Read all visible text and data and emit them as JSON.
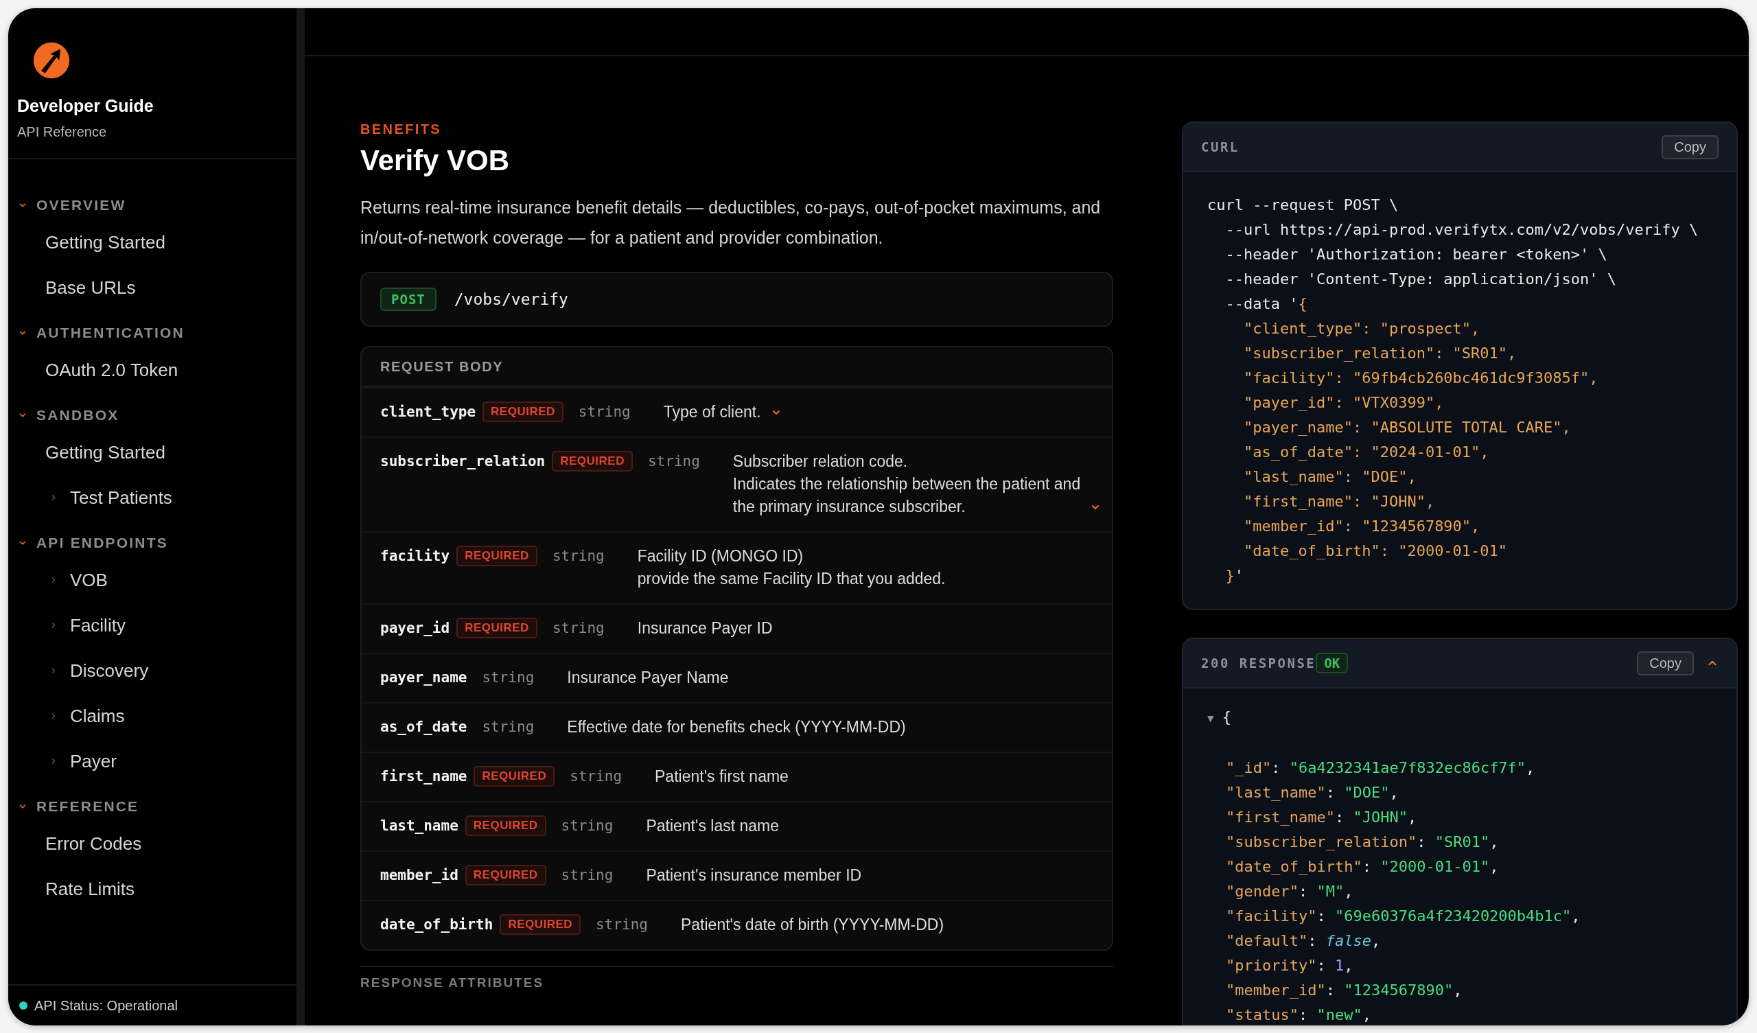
{
  "brand": {
    "title": "Developer Guide",
    "subtitle": "API Reference"
  },
  "nav": [
    {
      "label": "OVERVIEW",
      "expanded": true,
      "items": [
        {
          "label": "Getting Started",
          "kind": "link"
        },
        {
          "label": "Base URLs",
          "kind": "link"
        }
      ]
    },
    {
      "label": "AUTHENTICATION",
      "expanded": true,
      "items": [
        {
          "label": "OAuth 2.0 Token",
          "kind": "link"
        }
      ]
    },
    {
      "label": "SANDBOX",
      "expanded": true,
      "items": [
        {
          "label": "Getting Started",
          "kind": "link"
        },
        {
          "label": "Test Patients",
          "kind": "group",
          "expanded": false
        }
      ]
    },
    {
      "label": "API ENDPOINTS",
      "expanded": true,
      "items": [
        {
          "label": "VOB",
          "kind": "group",
          "expanded": false
        },
        {
          "label": "Facility",
          "kind": "group",
          "expanded": false
        },
        {
          "label": "Discovery",
          "kind": "group",
          "expanded": false
        },
        {
          "label": "Claims",
          "kind": "group",
          "expanded": false
        },
        {
          "label": "Payer",
          "kind": "group",
          "expanded": false
        }
      ]
    },
    {
      "label": "REFERENCE",
      "expanded": true,
      "items": [
        {
          "label": "Error Codes",
          "kind": "link"
        },
        {
          "label": "Rate Limits",
          "kind": "link"
        }
      ]
    }
  ],
  "status": {
    "text": "API Status: Operational",
    "color": "#2dd4bf"
  },
  "page": {
    "eyebrow": "BENEFITS",
    "title": "Verify VOB",
    "description": "Returns real-time insurance benefit details — deductibles, co-pays, out-of-pocket maximums, and in/out-of-network coverage — for a patient and provider combination."
  },
  "endpoint": {
    "method": "POST",
    "path": "/vobs/verify"
  },
  "request_body": {
    "heading": "REQUEST BODY",
    "fields": [
      {
        "name": "client_type",
        "badge": "REQUIRED",
        "type": "string",
        "description": [
          "Type of client."
        ],
        "expandable": true
      },
      {
        "name": "subscriber_relation",
        "badge": "REQUIRED",
        "type": "string",
        "description": [
          "Subscriber relation code.",
          "Indicates the relationship between the patient and",
          "the primary insurance subscriber."
        ],
        "expandable": true
      },
      {
        "name": "facility",
        "badge": "REQUIRED",
        "type": "string",
        "description": [
          "Facility ID (MONGO ID)",
          "provide the same Facility ID that you added."
        ],
        "expandable": false
      },
      {
        "name": "payer_id",
        "badge": "REQUIRED",
        "type": "string",
        "description": [
          "Insurance Payer ID"
        ],
        "expandable": false
      },
      {
        "name": "payer_name",
        "type": "string",
        "description": [
          "Insurance Payer Name"
        ],
        "expandable": false
      },
      {
        "name": "as_of_date",
        "type": "string",
        "description": [
          "Effective date for benefits check (YYYY-MM-DD)"
        ],
        "expandable": false
      },
      {
        "name": "first_name",
        "badge": "REQUIRED",
        "type": "string",
        "description": [
          "Patient's first name"
        ],
        "expandable": false
      },
      {
        "name": "last_name",
        "badge": "REQUIRED",
        "type": "string",
        "description": [
          "Patient's last name"
        ],
        "expandable": false
      },
      {
        "name": "member_id",
        "badge": "REQUIRED",
        "type": "string",
        "description": [
          "Patient's insurance member ID"
        ],
        "expandable": false
      },
      {
        "name": "date_of_birth",
        "badge": "REQUIRED",
        "type": "string",
        "description": [
          "Patient's date of birth (YYYY-MM-DD)"
        ],
        "expandable": false
      }
    ]
  },
  "response_heading": "RESPONSE ATTRIBUTES",
  "curl": {
    "label": "CURL",
    "copy": "Copy",
    "lines": [
      [
        {
          "text": "curl --request POST \\",
          "kind": "plain"
        }
      ],
      [
        {
          "text": "  --url https://api-prod.verifytx.com/v2/vobs/verify \\",
          "kind": "plain"
        }
      ],
      [
        {
          "text": "  --header 'Authorization: bearer <token>' \\",
          "kind": "plain"
        }
      ],
      [
        {
          "text": "  --header 'Content-Type: application/json' \\",
          "kind": "plain"
        }
      ],
      [
        {
          "text": "  --data '",
          "kind": "plain"
        },
        {
          "text": "{",
          "kind": "data"
        }
      ],
      [
        {
          "text": "    \"client_type\": \"prospect\",",
          "kind": "data"
        }
      ],
      [
        {
          "text": "    \"subscriber_relation\": \"SR01\",",
          "kind": "data"
        }
      ],
      [
        {
          "text": "    \"facility\": \"69fb4cb260bc461dc9f3085f\",",
          "kind": "data"
        }
      ],
      [
        {
          "text": "    \"payer_id\": \"VTX0399\",",
          "kind": "data"
        }
      ],
      [
        {
          "text": "    \"payer_name\": \"ABSOLUTE TOTAL CARE\",",
          "kind": "data"
        }
      ],
      [
        {
          "text": "    \"as_of_date\": \"2024-01-01\",",
          "kind": "data"
        }
      ],
      [
        {
          "text": "    \"last_name\": \"DOE\",",
          "kind": "data"
        }
      ],
      [
        {
          "text": "    \"first_name\": \"JOHN\",",
          "kind": "data"
        }
      ],
      [
        {
          "text": "    \"member_id\": \"1234567890\",",
          "kind": "data"
        }
      ],
      [
        {
          "text": "    \"date_of_birth\": \"2000-01-01\"",
          "kind": "data"
        }
      ],
      [
        {
          "text": "  }",
          "kind": "data"
        },
        {
          "text": "'",
          "kind": "plain"
        }
      ]
    ]
  },
  "response": {
    "code": "200 RESPONSE",
    "badge": "OK",
    "copy": "Copy",
    "expanded": true,
    "toggle": "▼",
    "open": "{",
    "lines": [
      [
        {
          "text": "\"_id\"",
          "kind": "key"
        },
        {
          "text": ": ",
          "kind": "plain"
        },
        {
          "text": "\"6a4232341ae7f832ec86cf7f\"",
          "kind": "str"
        },
        {
          "text": ",",
          "kind": "plain"
        }
      ],
      [
        {
          "text": "\"last_name\"",
          "kind": "key"
        },
        {
          "text": ": ",
          "kind": "plain"
        },
        {
          "text": "\"DOE\"",
          "kind": "str"
        },
        {
          "text": ",",
          "kind": "plain"
        }
      ],
      [
        {
          "text": "\"first_name\"",
          "kind": "key"
        },
        {
          "text": ": ",
          "kind": "plain"
        },
        {
          "text": "\"JOHN\"",
          "kind": "str"
        },
        {
          "text": ",",
          "kind": "plain"
        }
      ],
      [
        {
          "text": "\"subscriber_relation\"",
          "kind": "key"
        },
        {
          "text": ": ",
          "kind": "plain"
        },
        {
          "text": "\"SR01\"",
          "kind": "str"
        },
        {
          "text": ",",
          "kind": "plain"
        }
      ],
      [
        {
          "text": "\"date_of_birth\"",
          "kind": "key"
        },
        {
          "text": ": ",
          "kind": "plain"
        },
        {
          "text": "\"2000-01-01\"",
          "kind": "str"
        },
        {
          "text": ",",
          "kind": "plain"
        }
      ],
      [
        {
          "text": "\"gender\"",
          "kind": "key"
        },
        {
          "text": ": ",
          "kind": "plain"
        },
        {
          "text": "\"M\"",
          "kind": "str"
        },
        {
          "text": ",",
          "kind": "plain"
        }
      ],
      [
        {
          "text": "\"facility\"",
          "kind": "key"
        },
        {
          "text": ": ",
          "kind": "plain"
        },
        {
          "text": "\"69e60376a4f23420200b4b1c\"",
          "kind": "str"
        },
        {
          "text": ",",
          "kind": "plain"
        }
      ],
      [
        {
          "text": "\"default\"",
          "kind": "key"
        },
        {
          "text": ": ",
          "kind": "plain"
        },
        {
          "text": "false",
          "kind": "bool"
        },
        {
          "text": ",",
          "kind": "plain"
        }
      ],
      [
        {
          "text": "\"priority\"",
          "kind": "key"
        },
        {
          "text": ": ",
          "kind": "plain"
        },
        {
          "text": "1",
          "kind": "num"
        },
        {
          "text": ",",
          "kind": "plain"
        }
      ],
      [
        {
          "text": "\"member_id\"",
          "kind": "key"
        },
        {
          "text": ": ",
          "kind": "plain"
        },
        {
          "text": "\"1234567890\"",
          "kind": "str"
        },
        {
          "text": ",",
          "kind": "plain"
        }
      ],
      [
        {
          "text": "\"status\"",
          "kind": "key"
        },
        {
          "text": ": ",
          "kind": "plain"
        },
        {
          "text": "\"new\"",
          "kind": "str"
        },
        {
          "text": ",",
          "kind": "plain"
        }
      ]
    ]
  }
}
